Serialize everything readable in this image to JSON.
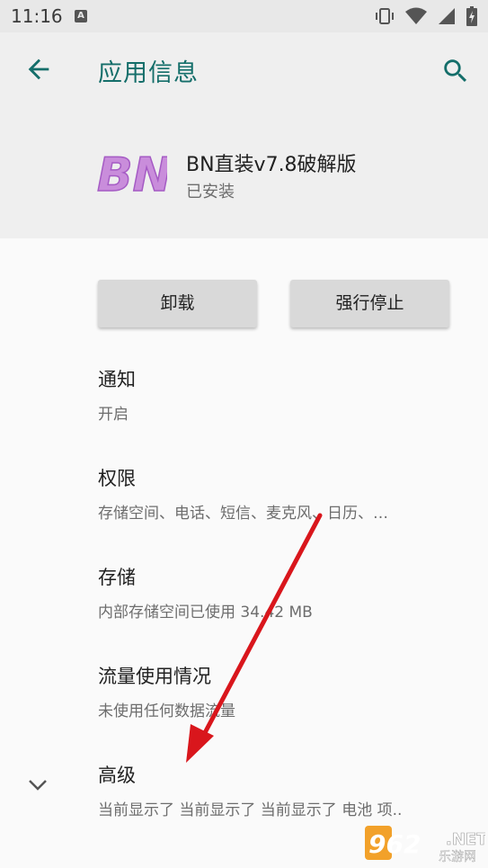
{
  "status_bar": {
    "time": "11:16",
    "notification_icon": "A",
    "icons": [
      "vibrate-icon",
      "wifi-icon",
      "signal-icon",
      "battery-charging-icon"
    ]
  },
  "header": {
    "title": "应用信息",
    "back_icon": "arrow-back-icon",
    "search_icon": "search-icon",
    "accent_color": "#146e6a"
  },
  "app": {
    "icon_text": "BN",
    "name": "BN直装v7.8破解版",
    "status": "已安装"
  },
  "actions": {
    "uninstall_label": "卸载",
    "force_stop_label": "强行停止"
  },
  "settings": [
    {
      "title": "通知",
      "summary": "开启"
    },
    {
      "title": "权限",
      "summary": "存储空间、电话、短信、麦克风、日历、…"
    },
    {
      "title": "存储",
      "summary": "内部存储空间已使用 34.42 MB"
    },
    {
      "title": "流量使用情况",
      "summary": "未使用任何数据流量"
    },
    {
      "title": "高级",
      "summary": "当前显示了 当前显示了 当前显示了 电池 项.."
    }
  ],
  "watermark": {
    "number": "962",
    "suffix": ".NET",
    "subtitle": "乐游网"
  },
  "annotation_color": "#d9161c"
}
